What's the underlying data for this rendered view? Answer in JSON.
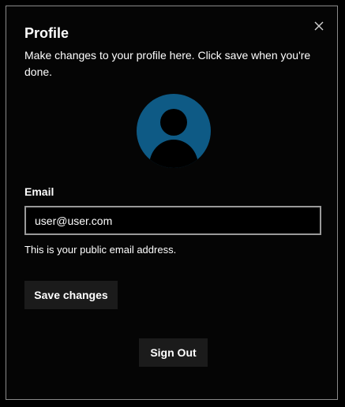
{
  "dialog": {
    "title": "Profile",
    "description": "Make changes to your profile here. Click save when you're done.",
    "close_icon": "close-icon",
    "avatar_icon": "user-avatar-icon",
    "email": {
      "label": "Email",
      "value": "user@user.com",
      "helper": "This is your public email address."
    },
    "save_label": "Save changes",
    "sign_out_label": "Sign Out"
  },
  "colors": {
    "avatar_background": "#0e5a85",
    "avatar_figure": "#000000",
    "button_background": "#1b1b1b",
    "border": "#8a8a8a"
  }
}
